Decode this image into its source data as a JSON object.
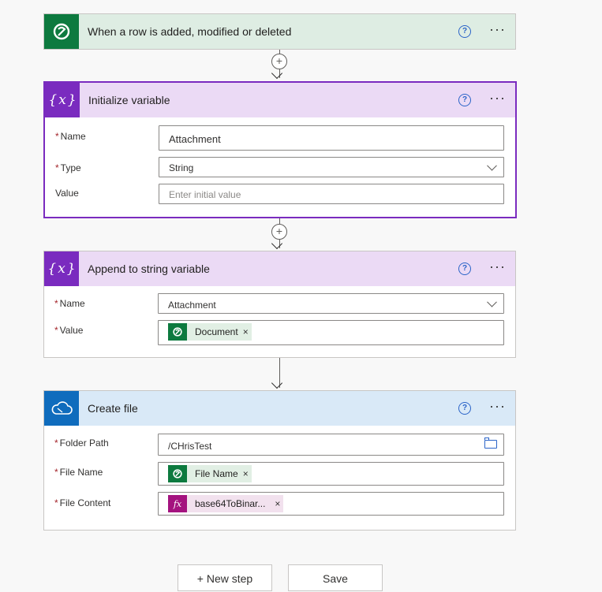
{
  "trigger": {
    "title": "When a row is added, modified or deleted",
    "help": "?",
    "more": "···"
  },
  "init": {
    "title": "Initialize variable",
    "help": "?",
    "more": "···",
    "name_label": "Name",
    "name_value": "Attachment",
    "type_label": "Type",
    "type_value": "String",
    "value_label": "Value",
    "value_placeholder": "Enter initial value"
  },
  "append": {
    "title": "Append to string variable",
    "help": "?",
    "more": "···",
    "name_label": "Name",
    "name_value": "Attachment",
    "value_label": "Value",
    "value_token": "Document",
    "token_close": "×"
  },
  "create": {
    "title": "Create file",
    "help": "?",
    "more": "···",
    "folder_label": "Folder Path",
    "folder_value": "/CHrisTest",
    "filename_label": "File Name",
    "filename_token": "File Name",
    "content_label": "File Content",
    "content_token": "base64ToBinar...",
    "token_close": "×"
  },
  "required_mark": "*",
  "connector": {
    "plus": "+"
  },
  "footer": {
    "new_step": "+ New step",
    "save": "Save"
  },
  "colors": {
    "dataverse": "#0d7a3f",
    "variable": "#7a2bbf",
    "onedrive": "#0f6cbd",
    "expression": "#a4137f"
  }
}
